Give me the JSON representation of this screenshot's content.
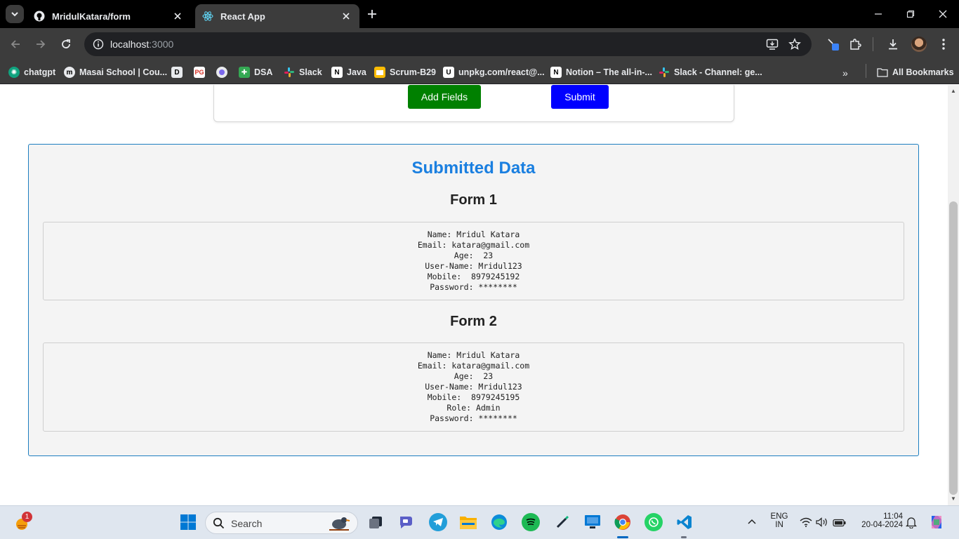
{
  "browser": {
    "tabs": [
      {
        "title": "MridulKatara/form",
        "active": false
      },
      {
        "title": "React App",
        "active": true
      }
    ],
    "address": {
      "host": "localhost",
      "port": ":3000"
    },
    "bookmarks": [
      {
        "label": "chatgpt",
        "color": "#10a37f"
      },
      {
        "label": "Masai School | Cou...",
        "color": "#e8eaed"
      },
      {
        "label": "",
        "color": "#e8eaed"
      },
      {
        "label": "",
        "color": "#d93025"
      },
      {
        "label": "",
        "color": "#7b68ee"
      },
      {
        "label": "DSA",
        "color": "#34a853"
      },
      {
        "label": "Slack",
        "color": "#e01e5a"
      },
      {
        "label": "Java",
        "color": "#ffffff"
      },
      {
        "label": "Scrum-B29",
        "color": "#fbbc04"
      },
      {
        "label": "unpkg.com/react@...",
        "color": "#ffffff"
      },
      {
        "label": "Notion – The all-in-...",
        "color": "#ffffff"
      },
      {
        "label": "Slack - Channel: ge...",
        "color": "#e01e5a"
      }
    ],
    "all_bookmarks": "All Bookmarks"
  },
  "page": {
    "buttons": {
      "add_fields": "Add Fields",
      "submit": "Submit"
    },
    "submitted_title": "Submitted Data",
    "forms": [
      {
        "title": "Form 1",
        "lines": [
          "Name: Mridul Katara",
          "Email: katara@gmail.com",
          "Age:  23",
          "User-Name: Mridul123",
          "Mobile:  8979245192",
          "Password: ********"
        ]
      },
      {
        "title": "Form 2",
        "lines": [
          "Name: Mridul Katara",
          "Email: katara@gmail.com",
          "Age:  23",
          "User-Name: Mridul123",
          "Mobile:  8979245195",
          "Role: Admin",
          "Password: ********"
        ]
      }
    ]
  },
  "taskbar": {
    "search_placeholder": "Search",
    "notification_badge": "1",
    "lang_top": "ENG",
    "lang_bottom": "IN",
    "time": "11:04",
    "date": "20-04-2024"
  }
}
